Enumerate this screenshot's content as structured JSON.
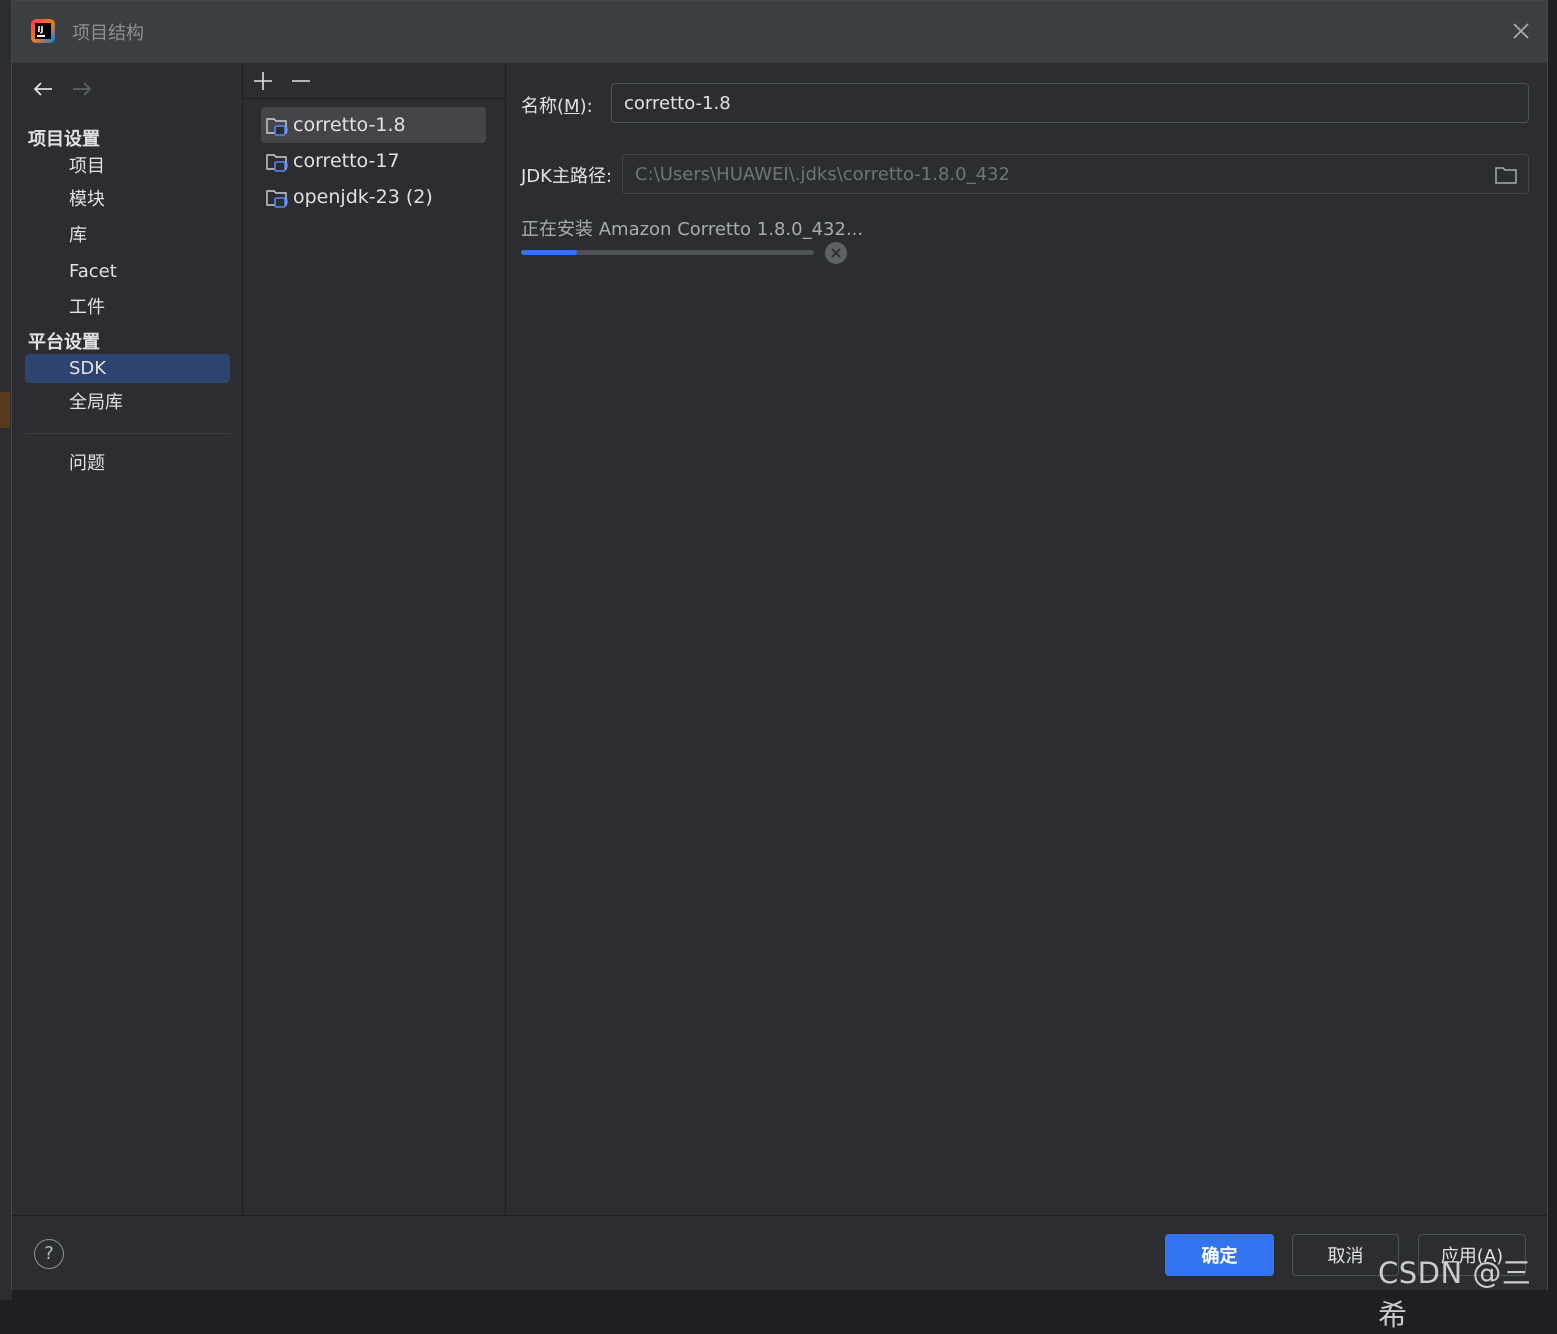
{
  "window": {
    "title": "项目结构"
  },
  "nav": {
    "back": "back-arrow-icon",
    "forward": "forward-arrow-icon"
  },
  "sidebar": {
    "project_settings": {
      "header": "项目设置",
      "items": [
        {
          "label": "项目"
        },
        {
          "label": "模块"
        },
        {
          "label": "库"
        },
        {
          "label": "Facet"
        },
        {
          "label": "工件"
        }
      ]
    },
    "platform_settings": {
      "header": "平台设置",
      "items": [
        {
          "label": "SDK",
          "selected": true
        },
        {
          "label": "全局库"
        }
      ]
    },
    "problems": {
      "label": "问题"
    }
  },
  "sdk_list": {
    "toolbar": {
      "add": "+",
      "remove": "—"
    },
    "items": [
      {
        "label": "corretto-1.8",
        "selected": true
      },
      {
        "label": "corretto-17"
      },
      {
        "label": "openjdk-23 (2)"
      }
    ]
  },
  "details": {
    "name_label_prefix": "名称(",
    "name_label_mnemonic": "M",
    "name_label_suffix": "):",
    "name_value": "corretto-1.8",
    "jdk_home_label": "JDK主路径:",
    "jdk_home_value": "C:\\Users\\HUAWEI\\.jdks\\corretto-1.8.0_432",
    "install_status": "正在安装 Amazon Corretto 1.8.0_432...",
    "install_progress": 0.19
  },
  "footer": {
    "help": "?",
    "ok": "确定",
    "cancel": "取消",
    "apply": "应用(A)"
  },
  "watermark": "CSDN @三希",
  "colors": {
    "accent": "#3574f0",
    "selection": "#2e436e",
    "background": "#2b2d30",
    "titlebar": "#3c3f41"
  }
}
